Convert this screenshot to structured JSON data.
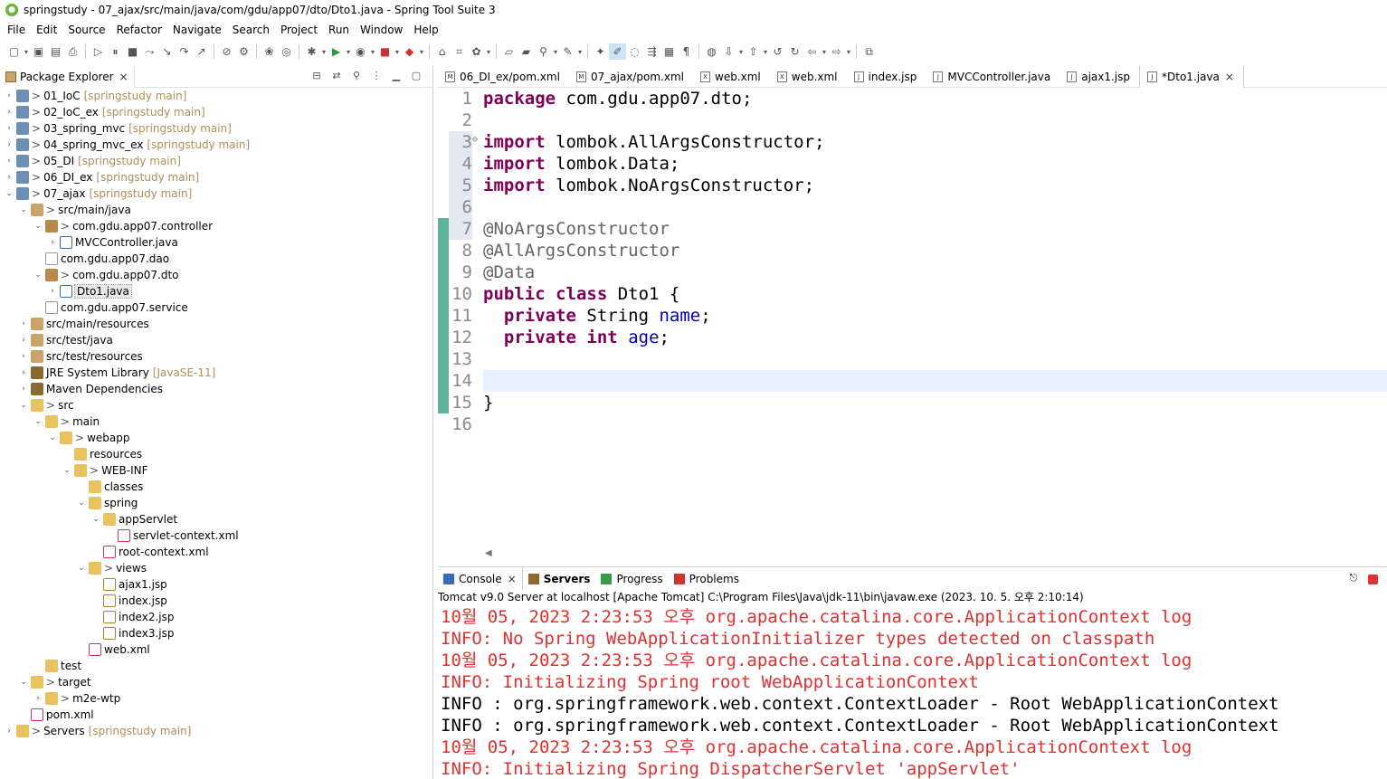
{
  "window": {
    "title": "springstudy - 07_ajax/src/main/java/com/gdu/app07/dto/Dto1.java - Spring Tool Suite 3"
  },
  "menu": [
    "File",
    "Edit",
    "Source",
    "Refactor",
    "Navigate",
    "Search",
    "Project",
    "Run",
    "Window",
    "Help"
  ],
  "explorer": {
    "tab_label": "Package Explorer",
    "tree": [
      {
        "label": "01_IoC",
        "repo": "[springstudy main]",
        "depth": 0,
        "twisty": "collapsed",
        "icon": "project",
        "marker": ">"
      },
      {
        "label": "02_IoC_ex",
        "repo": "[springstudy main]",
        "depth": 0,
        "twisty": "collapsed",
        "icon": "project",
        "marker": ">"
      },
      {
        "label": "03_spring_mvc",
        "repo": "[springstudy main]",
        "depth": 0,
        "twisty": "collapsed",
        "icon": "project",
        "marker": ">"
      },
      {
        "label": "04_spring_mvc_ex",
        "repo": "[springstudy main]",
        "depth": 0,
        "twisty": "collapsed",
        "icon": "project",
        "marker": ">"
      },
      {
        "label": "05_DI",
        "repo": "[springstudy main]",
        "depth": 0,
        "twisty": "collapsed",
        "icon": "project",
        "marker": ">"
      },
      {
        "label": "06_DI_ex",
        "repo": "[springstudy main]",
        "depth": 0,
        "twisty": "collapsed",
        "icon": "project",
        "marker": ">"
      },
      {
        "label": "07_ajax",
        "repo": "[springstudy main]",
        "depth": 0,
        "twisty": "expanded",
        "icon": "project",
        "marker": ">"
      },
      {
        "label": "src/main/java",
        "repo": "",
        "depth": 1,
        "twisty": "expanded",
        "icon": "srcfolder",
        "marker": ">"
      },
      {
        "label": "com.gdu.app07.controller",
        "repo": "",
        "depth": 2,
        "twisty": "expanded",
        "icon": "package",
        "marker": ">"
      },
      {
        "label": "MVCController.java",
        "repo": "",
        "depth": 3,
        "twisty": "collapsed",
        "icon": "java",
        "marker": ""
      },
      {
        "label": "com.gdu.app07.dao",
        "repo": "",
        "depth": 2,
        "twisty": "none",
        "icon": "package-empty",
        "marker": ""
      },
      {
        "label": "com.gdu.app07.dto",
        "repo": "",
        "depth": 2,
        "twisty": "expanded",
        "icon": "package",
        "marker": ">"
      },
      {
        "label": "Dto1.java",
        "repo": "",
        "depth": 3,
        "twisty": "collapsed",
        "icon": "java",
        "marker": "",
        "selected": true
      },
      {
        "label": "com.gdu.app07.service",
        "repo": "",
        "depth": 2,
        "twisty": "none",
        "icon": "package-empty",
        "marker": ""
      },
      {
        "label": "src/main/resources",
        "repo": "",
        "depth": 1,
        "twisty": "collapsed",
        "icon": "srcfolder",
        "marker": ""
      },
      {
        "label": "src/test/java",
        "repo": "",
        "depth": 1,
        "twisty": "collapsed",
        "icon": "srcfolder",
        "marker": ""
      },
      {
        "label": "src/test/resources",
        "repo": "",
        "depth": 1,
        "twisty": "collapsed",
        "icon": "srcfolder",
        "marker": ""
      },
      {
        "label": "JRE System Library",
        "repo": "[JavaSE-11]",
        "depth": 1,
        "twisty": "collapsed",
        "icon": "library",
        "marker": ""
      },
      {
        "label": "Maven Dependencies",
        "repo": "",
        "depth": 1,
        "twisty": "collapsed",
        "icon": "library",
        "marker": ""
      },
      {
        "label": "src",
        "repo": "",
        "depth": 1,
        "twisty": "expanded",
        "icon": "folder",
        "marker": ">"
      },
      {
        "label": "main",
        "repo": "",
        "depth": 2,
        "twisty": "expanded",
        "icon": "folder",
        "marker": ">"
      },
      {
        "label": "webapp",
        "repo": "",
        "depth": 3,
        "twisty": "expanded",
        "icon": "folder",
        "marker": ">"
      },
      {
        "label": "resources",
        "repo": "",
        "depth": 4,
        "twisty": "none",
        "icon": "folder",
        "marker": ""
      },
      {
        "label": "WEB-INF",
        "repo": "",
        "depth": 4,
        "twisty": "expanded",
        "icon": "folder",
        "marker": ">"
      },
      {
        "label": "classes",
        "repo": "",
        "depth": 5,
        "twisty": "none",
        "icon": "folder",
        "marker": ""
      },
      {
        "label": "spring",
        "repo": "",
        "depth": 5,
        "twisty": "expanded",
        "icon": "folder",
        "marker": ""
      },
      {
        "label": "appServlet",
        "repo": "",
        "depth": 6,
        "twisty": "expanded",
        "icon": "folder",
        "marker": ""
      },
      {
        "label": "servlet-context.xml",
        "repo": "",
        "depth": 7,
        "twisty": "none",
        "icon": "xml",
        "marker": ""
      },
      {
        "label": "root-context.xml",
        "repo": "",
        "depth": 6,
        "twisty": "none",
        "icon": "xml",
        "marker": ""
      },
      {
        "label": "views",
        "repo": "",
        "depth": 5,
        "twisty": "expanded",
        "icon": "folder",
        "marker": ">"
      },
      {
        "label": "ajax1.jsp",
        "repo": "",
        "depth": 6,
        "twisty": "none",
        "icon": "jsp",
        "marker": ""
      },
      {
        "label": "index.jsp",
        "repo": "",
        "depth": 6,
        "twisty": "none",
        "icon": "jsp",
        "marker": ""
      },
      {
        "label": "index2.jsp",
        "repo": "",
        "depth": 6,
        "twisty": "none",
        "icon": "jsp",
        "marker": ""
      },
      {
        "label": "index3.jsp",
        "repo": "",
        "depth": 6,
        "twisty": "none",
        "icon": "jsp",
        "marker": ""
      },
      {
        "label": "web.xml",
        "repo": "",
        "depth": 5,
        "twisty": "none",
        "icon": "xml",
        "marker": ""
      },
      {
        "label": "test",
        "repo": "",
        "depth": 2,
        "twisty": "none",
        "icon": "folder",
        "marker": ""
      },
      {
        "label": "target",
        "repo": "",
        "depth": 1,
        "twisty": "expanded",
        "icon": "folder",
        "marker": ">"
      },
      {
        "label": "m2e-wtp",
        "repo": "",
        "depth": 2,
        "twisty": "collapsed",
        "icon": "folder",
        "marker": ">"
      },
      {
        "label": "pom.xml",
        "repo": "",
        "depth": 1,
        "twisty": "none",
        "icon": "xml",
        "marker": ""
      },
      {
        "label": "Servers",
        "repo": "[springstudy main]",
        "depth": 0,
        "twisty": "collapsed",
        "icon": "folder",
        "marker": ">"
      }
    ]
  },
  "editor": {
    "tabs": [
      {
        "label": "06_DI_ex/pom.xml",
        "icon": "M",
        "active": false
      },
      {
        "label": "07_ajax/pom.xml",
        "icon": "M",
        "active": false
      },
      {
        "label": "web.xml",
        "icon": "X",
        "active": false
      },
      {
        "label": "web.xml",
        "icon": "X",
        "active": false
      },
      {
        "label": "index.jsp",
        "icon": "J",
        "active": false
      },
      {
        "label": "MVCController.java",
        "icon": "J",
        "active": false
      },
      {
        "label": "ajax1.jsp",
        "icon": "J",
        "active": false
      },
      {
        "label": "*Dto1.java",
        "icon": "J",
        "active": true
      }
    ],
    "lines": [
      [
        [
          "kw",
          "package"
        ],
        [
          "",
          " com.gdu.app07.dto;"
        ]
      ],
      [],
      [
        [
          "kw",
          "import"
        ],
        [
          "",
          " lombok.AllArgsConstructor;"
        ]
      ],
      [
        [
          "kw",
          "import"
        ],
        [
          "",
          " lombok.Data;"
        ]
      ],
      [
        [
          "kw",
          "import"
        ],
        [
          "",
          " lombok.NoArgsConstructor;"
        ]
      ],
      [],
      [
        [
          "ann",
          "@NoArgsConstructor"
        ]
      ],
      [
        [
          "ann",
          "@AllArgsConstructor"
        ]
      ],
      [
        [
          "ann",
          "@Data"
        ]
      ],
      [
        [
          "kw",
          "public"
        ],
        [
          "",
          " "
        ],
        [
          "kw",
          "class"
        ],
        [
          "",
          " Dto1 {"
        ]
      ],
      [
        [
          "",
          "  "
        ],
        [
          "kw",
          "private"
        ],
        [
          "",
          " String "
        ],
        [
          "fld",
          "name"
        ],
        [
          "",
          ";"
        ]
      ],
      [
        [
          "",
          "  "
        ],
        [
          "kw",
          "private"
        ],
        [
          "",
          " "
        ],
        [
          "kw",
          "int"
        ],
        [
          "",
          " "
        ],
        [
          "fld",
          "age"
        ],
        [
          "",
          ";"
        ]
      ],
      [],
      [],
      [
        [
          "",
          "}"
        ]
      ],
      []
    ]
  },
  "console": {
    "tabs": [
      {
        "label": "Console",
        "active": true,
        "bold": false,
        "close": "×"
      },
      {
        "label": "Servers",
        "active": false,
        "bold": true
      },
      {
        "label": "Progress",
        "active": false,
        "bold": false
      },
      {
        "label": "Problems",
        "active": false,
        "bold": false
      }
    ],
    "description": "Tomcat v9.0 Server at localhost [Apache Tomcat] C:\\Program Files\\Java\\jdk-11\\bin\\javaw.exe  (2023. 10. 5. 오후 2:10:14)",
    "lines": [
      {
        "text": "10월 05, 2023 2:23:53 오후 org.apache.catalina.core.ApplicationContext log",
        "kind": "err"
      },
      {
        "text": "INFO: No Spring WebApplicationInitializer types detected on classpath",
        "kind": "err"
      },
      {
        "text": "10월 05, 2023 2:23:53 오후 org.apache.catalina.core.ApplicationContext log",
        "kind": "err"
      },
      {
        "text": "INFO: Initializing Spring root WebApplicationContext",
        "kind": "err"
      },
      {
        "text": "INFO : org.springframework.web.context.ContextLoader - Root WebApplicationContext",
        "kind": "out"
      },
      {
        "text": "INFO : org.springframework.web.context.ContextLoader - Root WebApplicationContext",
        "kind": "out"
      },
      {
        "text": "10월 05, 2023 2:23:53 오후 org.apache.catalina.core.ApplicationContext log",
        "kind": "err"
      },
      {
        "text": "INFO: Initializing Spring DispatcherServlet 'appServlet'",
        "kind": "err"
      }
    ]
  }
}
